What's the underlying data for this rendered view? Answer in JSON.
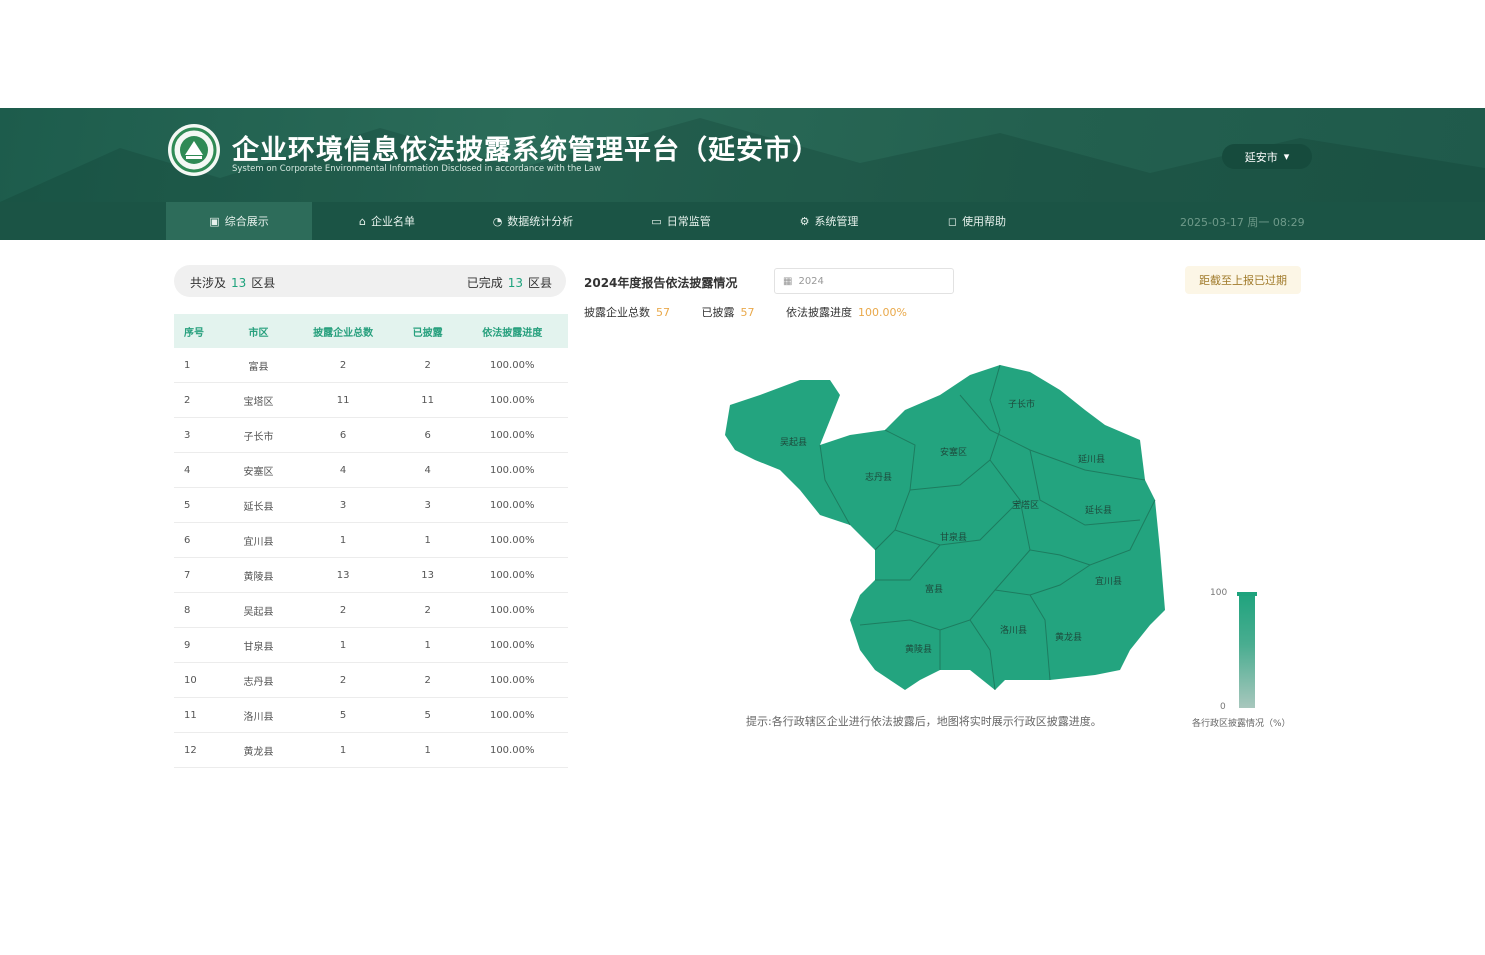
{
  "header": {
    "title": "企业环境信息依法披露系统管理平台（延安市）",
    "subtitle": "System on Corporate Environmental Information Disclosed in accordance with the Law",
    "city_select": "延安市"
  },
  "nav": {
    "items": [
      {
        "label": "综合展示",
        "icon": "grid-icon"
      },
      {
        "label": "企业名单",
        "icon": "home-icon"
      },
      {
        "label": "数据统计分析",
        "icon": "chart-icon"
      },
      {
        "label": "日常监管",
        "icon": "monitor-icon"
      },
      {
        "label": "系统管理",
        "icon": "gear-icon"
      },
      {
        "label": "使用帮助",
        "icon": "help-icon"
      }
    ],
    "datetime": "2025-03-17 周一 08:29"
  },
  "summary": {
    "left_prefix": "共涉及",
    "left_count": "13",
    "left_suffix": "区县",
    "right_prefix": "已完成",
    "right_count": "13",
    "right_suffix": "区县"
  },
  "table": {
    "headers": [
      "序号",
      "市区",
      "披露企业总数",
      "已披露",
      "依法披露进度"
    ],
    "rows": [
      [
        "1",
        "富县",
        "2",
        "2",
        "100.00%"
      ],
      [
        "2",
        "宝塔区",
        "11",
        "11",
        "100.00%"
      ],
      [
        "3",
        "子长市",
        "6",
        "6",
        "100.00%"
      ],
      [
        "4",
        "安塞区",
        "4",
        "4",
        "100.00%"
      ],
      [
        "5",
        "延长县",
        "3",
        "3",
        "100.00%"
      ],
      [
        "6",
        "宜川县",
        "1",
        "1",
        "100.00%"
      ],
      [
        "7",
        "黄陵县",
        "13",
        "13",
        "100.00%"
      ],
      [
        "8",
        "吴起县",
        "2",
        "2",
        "100.00%"
      ],
      [
        "9",
        "甘泉县",
        "1",
        "1",
        "100.00%"
      ],
      [
        "10",
        "志丹县",
        "2",
        "2",
        "100.00%"
      ],
      [
        "11",
        "洛川县",
        "5",
        "5",
        "100.00%"
      ],
      [
        "12",
        "黄龙县",
        "1",
        "1",
        "100.00%"
      ]
    ]
  },
  "report": {
    "title": "2024年度报告依法披露情况",
    "year_value": "2024",
    "deadline": "距截至上报已过期",
    "stats": [
      {
        "label": "披露企业总数",
        "value": "57"
      },
      {
        "label": "已披露",
        "value": "57"
      },
      {
        "label": "依法披露进度",
        "value": "100.00%"
      }
    ]
  },
  "map": {
    "fill_color": "#23a47f",
    "labels": [
      "吴起县",
      "志丹县",
      "安塞区",
      "子长市",
      "延川县",
      "宝塔区",
      "延长县",
      "甘泉县",
      "富县",
      "宜川县",
      "洛川县",
      "黄陵县",
      "黄龙县"
    ],
    "hint": "提示:各行政辖区企业进行依法披露后，地图将实时展示行政区披露进度。",
    "legend_max": "100",
    "legend_min": "0",
    "legend_caption": "各行政区披露情况（%）"
  }
}
